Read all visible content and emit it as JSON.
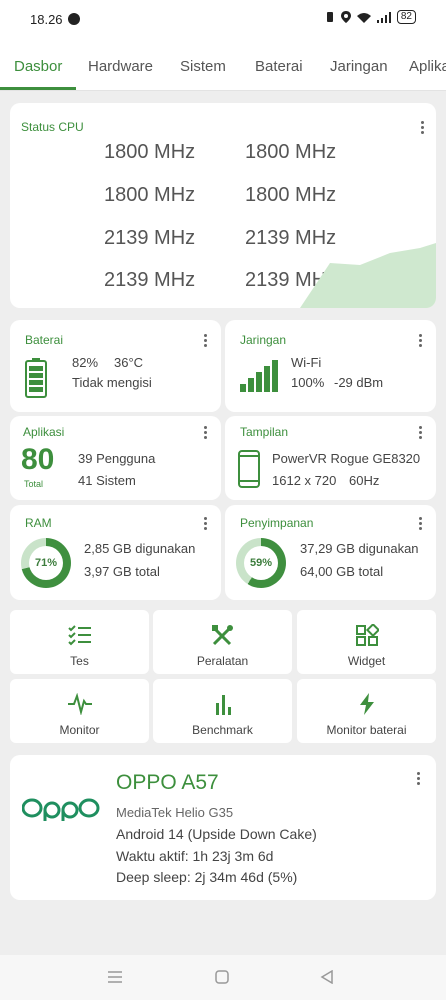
{
  "status_bar": {
    "time": "18.26",
    "battery": "82"
  },
  "tabs": [
    {
      "label": "Dasbor",
      "active": true
    },
    {
      "label": "Hardware"
    },
    {
      "label": "Sistem"
    },
    {
      "label": "Baterai"
    },
    {
      "label": "Jaringan"
    },
    {
      "label": "Aplika"
    }
  ],
  "cpu": {
    "title": "Status CPU",
    "cores": [
      "1800 MHz",
      "1800 MHz",
      "1800 MHz",
      "1800 MHz",
      "2139 MHz",
      "2139 MHz",
      "2139 MHz",
      "2139 MHz"
    ]
  },
  "battery": {
    "title": "Baterai",
    "percent": "82%",
    "temp": "36°C",
    "status": "Tidak mengisi"
  },
  "network": {
    "title": "Jaringan",
    "type": "Wi-Fi",
    "signal": "100%",
    "dbm": "-29 dBm"
  },
  "apps": {
    "title": "Aplikasi",
    "total": "80",
    "total_label": "Total",
    "user": "39 Pengguna",
    "system": "41 Sistem"
  },
  "display": {
    "title": "Tampilan",
    "gpu": "PowerVR Rogue GE8320",
    "resolution": "1612 x 720",
    "refresh": "60Hz"
  },
  "ram": {
    "title": "RAM",
    "percent": "71%",
    "percent_value": 71,
    "used": "2,85 GB digunakan",
    "total": "3,97 GB total"
  },
  "storage": {
    "title": "Penyimpanan",
    "percent": "59%",
    "percent_value": 59,
    "used": "37,29 GB digunakan",
    "total": "64,00 GB total"
  },
  "tools": [
    {
      "label": "Tes",
      "icon": "checklist-icon"
    },
    {
      "label": "Peralatan",
      "icon": "tools-icon"
    },
    {
      "label": "Widget",
      "icon": "widget-icon"
    },
    {
      "label": "Monitor",
      "icon": "pulse-icon"
    },
    {
      "label": "Benchmark",
      "icon": "bar-chart-icon"
    },
    {
      "label": "Monitor baterai",
      "icon": "bolt-icon"
    }
  ],
  "device": {
    "brand_logo": "oppo",
    "model": "OPPO A57",
    "chipset": "MediaTek Helio G35",
    "android": "Android 14 (Upside Down Cake)",
    "uptime": "Waktu aktif: 1h 23j 3m 6d",
    "deep_sleep": "Deep sleep: 2j 34m 46d (5%)"
  },
  "colors": {
    "accent": "#3d8f3d",
    "ring_fill": "#3f8f3f",
    "ring_track": "#c9e3c9"
  }
}
